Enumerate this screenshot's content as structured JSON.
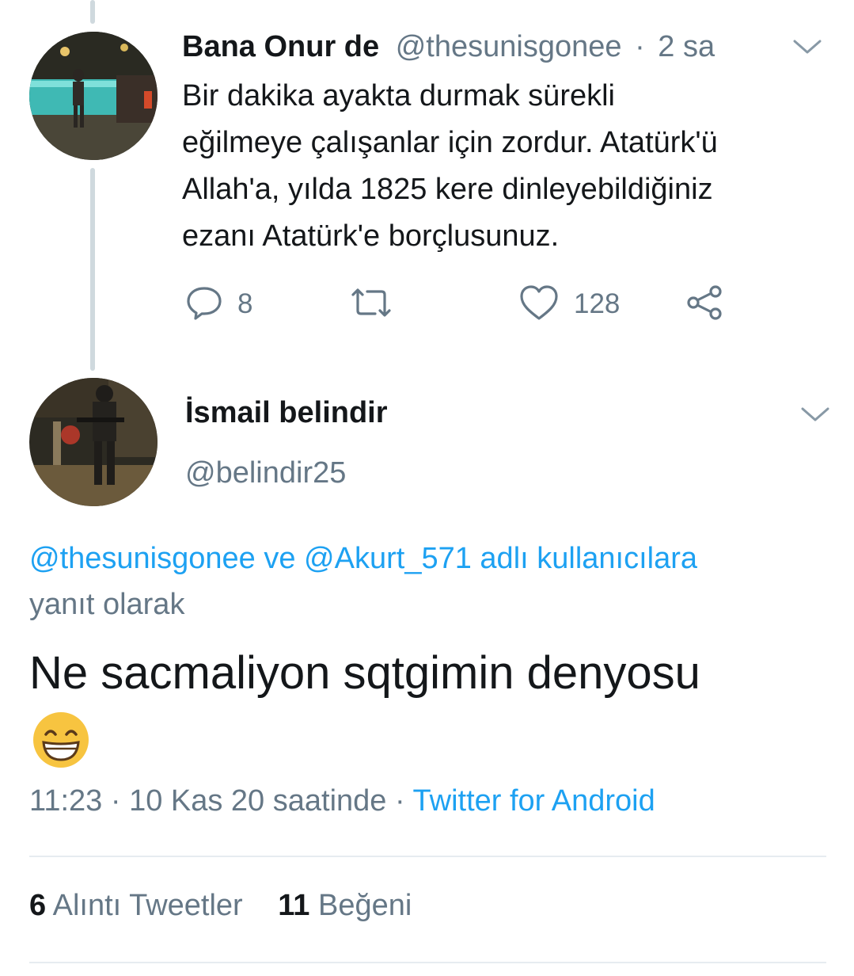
{
  "parent_tweet": {
    "author_name": "Bana Onur de",
    "handle": "@thesunisgonee",
    "separator": "·",
    "time_ago": "2 sa",
    "text_lines": [
      "Bir dakika ayakta durmak sürekli",
      "eğilmeye çalışanlar için zordur. Atatürk'ü",
      "Allah'a, yılda 1825 kere dinleyebildiğiniz",
      "ezanı Atatürk'e borçlusunuz."
    ],
    "actions": {
      "reply_count": "8",
      "retweet_count": "",
      "like_count": "128"
    }
  },
  "reply_tweet": {
    "author_name": "İsmail belindir",
    "handle": "@belindir25",
    "reply_to": {
      "mention_1": "@thesunisgonee",
      "joiner": "ve",
      "mention_2": "@Akurt_571",
      "suffix": "adlı kullanıcılara",
      "line2": "yanıt olarak"
    },
    "text": "Ne sacmaliyon sqtgimin denyosu",
    "emoji": "😁",
    "time": "11:23",
    "separator": "·",
    "date": "10 Kas 20 saatinde",
    "separator2": "·",
    "source": "Twitter for Android",
    "stats": {
      "quote_count": "6",
      "quote_label": "Alıntı Tweetler",
      "like_count": "11",
      "like_label": "Beğeni"
    }
  },
  "colors": {
    "accent": "#1da1f2",
    "secondary_text": "#657786",
    "primary_text": "#14171a",
    "thread_line": "#cfd9de",
    "divider": "#e6ecf0"
  },
  "icons": [
    "chevron-down-icon",
    "reply-icon",
    "retweet-icon",
    "like-icon",
    "share-icon",
    "grinning-emoji"
  ]
}
